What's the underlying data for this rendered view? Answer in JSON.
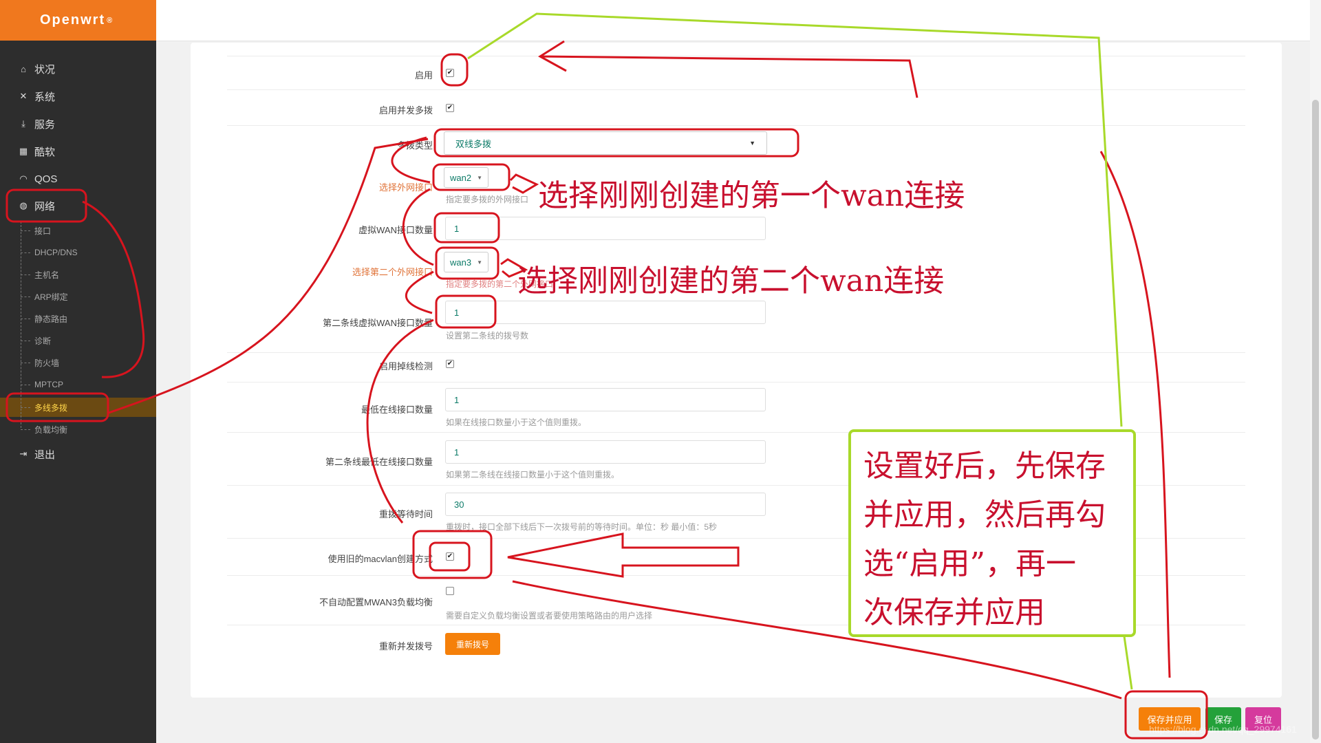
{
  "brand": {
    "name": "Openwrt",
    "mark": "®"
  },
  "sidebar": {
    "main_items": [
      {
        "label": "状况",
        "icon": "home-icon"
      },
      {
        "label": "系统",
        "icon": "tools-icon"
      },
      {
        "label": "服务",
        "icon": "download-icon"
      },
      {
        "label": "酷软",
        "icon": "calendar-icon"
      },
      {
        "label": "QOS",
        "icon": "gauge-icon"
      },
      {
        "label": "网络",
        "icon": "globe-icon"
      }
    ],
    "sub_items": [
      "接口",
      "DHCP/DNS",
      "主机名",
      "ARP绑定",
      "静态路由",
      "诊断",
      "防火墙",
      "MPTCP",
      "多线多拨",
      "负载均衡"
    ],
    "logout": {
      "label": "退出",
      "icon": "logout-icon"
    }
  },
  "form": {
    "enable": {
      "label": "启用",
      "checked": true
    },
    "concurrent": {
      "label": "启用并发多拨",
      "checked": true
    },
    "multi_type": {
      "label": "多拨类型",
      "value": "双线多拨"
    },
    "wan_select": {
      "label": "选择外网接口",
      "value": "wan2",
      "help": "指定要多拨的外网接口"
    },
    "vwan_count": {
      "label": "虚拟WAN接口数量",
      "value": "1"
    },
    "wan2_select": {
      "label": "选择第二个外网接口",
      "value": "wan3",
      "help": "指定要多拨的第二个外网接口"
    },
    "vwan2_count": {
      "label": "第二条线虚拟WAN接口数量",
      "value": "1",
      "help": "设置第二条线的拨号数"
    },
    "drop_detect": {
      "label": "启用掉线检测",
      "checked": true
    },
    "min_online": {
      "label": "最低在线接口数量",
      "value": "1",
      "help": "如果在线接口数量小于这个值则重拨。"
    },
    "min_online2": {
      "label": "第二条线最低在线接口数量",
      "value": "1",
      "help": "如果第二条线在线接口数量小于这个值则重拨。"
    },
    "redial_wait": {
      "label": "重拨等待时间",
      "value": "30",
      "help": "重拨时，接口全部下线后下一次拨号前的等待时间。单位：秒 最小值：5秒"
    },
    "old_macvlan": {
      "label": "使用旧的macvlan创建方式",
      "checked": true
    },
    "no_mwan3": {
      "label": "不自动配置MWAN3负载均衡",
      "checked": false,
      "help": "需要自定义负载均衡设置或者要使用策略路由的用户选择"
    },
    "redial": {
      "label": "重新并发拨号",
      "button": "重新拨号"
    }
  },
  "actions": {
    "apply": "保存并应用",
    "save": "保存",
    "reset": "复位"
  },
  "annotations": {
    "first_wan": "选择刚刚创建的第一个wan连接",
    "second_wan": "选择刚刚创建的第二个wan连接",
    "note_lines": [
      "设置好后，先保存",
      "并应用，然后再勾",
      "选“启用”，再一",
      "次保存并应用"
    ]
  },
  "watermark": "https://blog.csdn.net/qq_29974161",
  "colors": {
    "brand_orange": "#f0781e",
    "sidebar_bg": "#2d2d2d",
    "annotation_red": "#c8102e",
    "annotation_green": "#a8d92a",
    "apply_orange": "#f5800a",
    "save_green": "#24a13a",
    "reset_pink": "#d53a9d"
  }
}
